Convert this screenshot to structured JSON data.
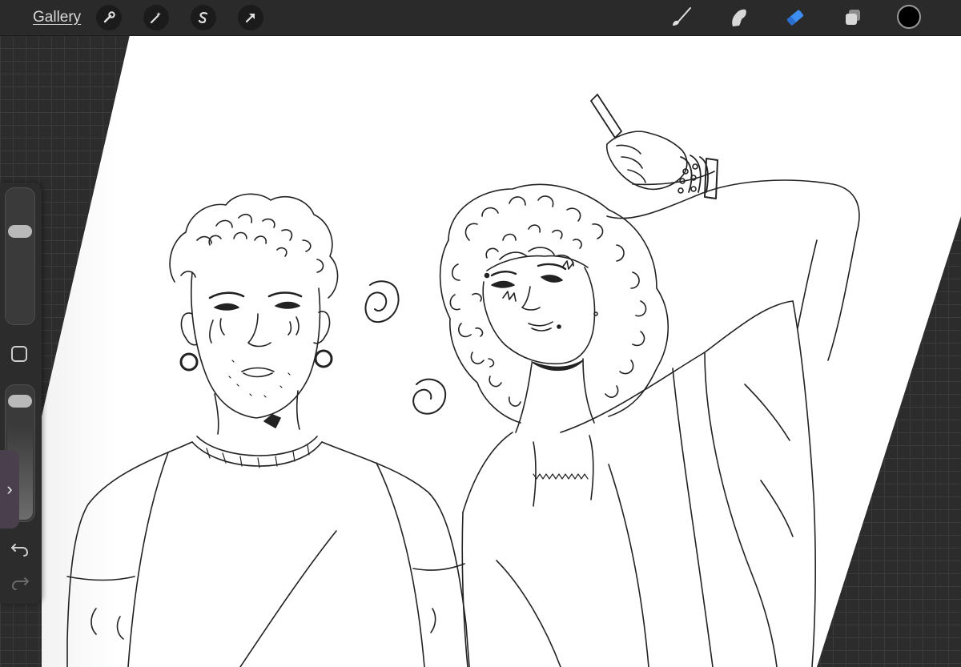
{
  "toolbar": {
    "gallery_label": "Gallery",
    "left_tools": [
      "wrench-icon",
      "magic-wand-icon",
      "selection-icon",
      "transform-arrow-icon"
    ],
    "right_tools": [
      "brush-icon",
      "smudge-icon",
      "eraser-icon",
      "layers-icon"
    ],
    "active_tool": "eraser",
    "active_tool_color": "#3d8ef0",
    "current_color": "#000000"
  },
  "sidebar": {
    "brush_size_level": 0.72,
    "opacity_level": 0.95,
    "handle_glyph": "›",
    "icons": [
      "modify-square-icon",
      "undo-icon",
      "redo-icon"
    ]
  },
  "canvas": {
    "paper_color": "#ffffff",
    "workspace_color": "#2c2c2c"
  }
}
